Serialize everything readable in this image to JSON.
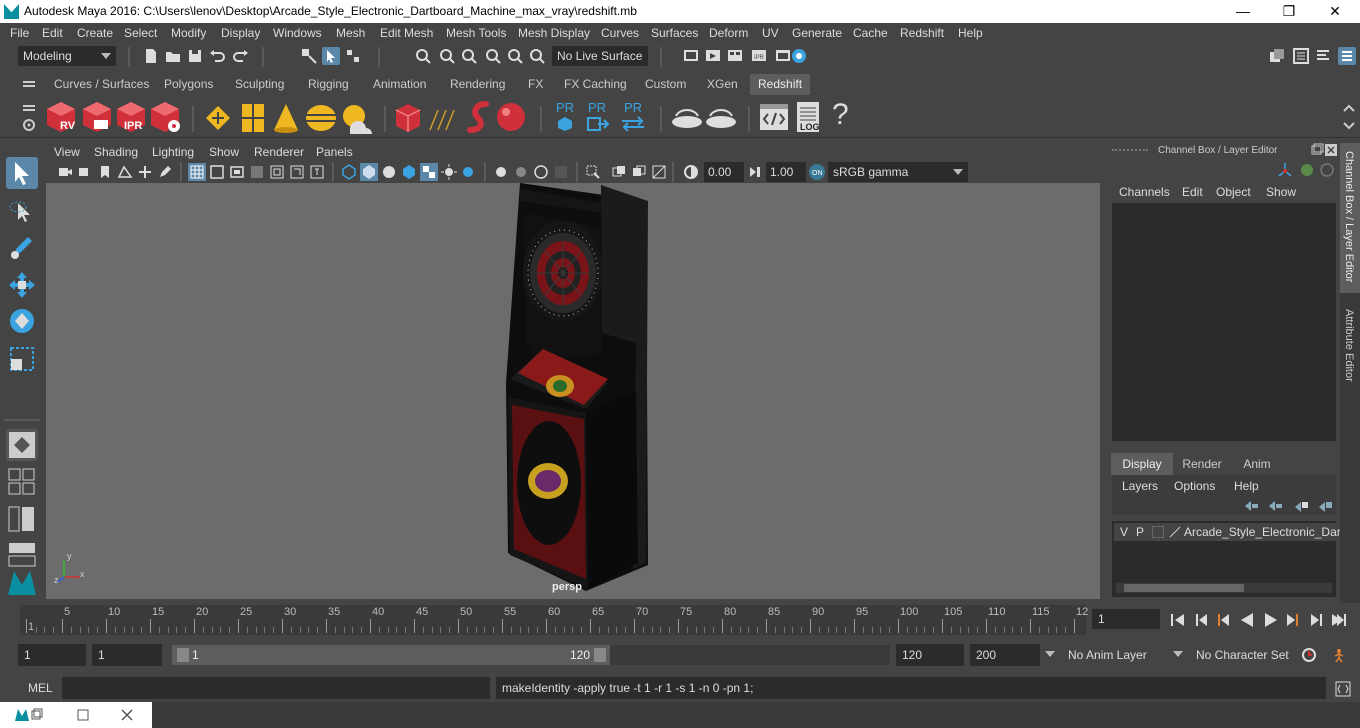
{
  "window": {
    "title": "Autodesk Maya 2016: C:\\Users\\lenov\\Desktop\\Arcade_Style_Electronic_Dartboard_Machine_max_vray\\redshift.mb",
    "minimize": "—",
    "maximize": "❐",
    "close": "✕"
  },
  "menubar": [
    "File",
    "Edit",
    "Create",
    "Select",
    "Modify",
    "Display",
    "Windows",
    "Mesh",
    "Edit Mesh",
    "Mesh Tools",
    "Mesh Display",
    "Curves",
    "Surfaces",
    "Deform",
    "UV",
    "Generate",
    "Cache",
    "Redshift",
    "Help"
  ],
  "statusline": {
    "mode": "Modeling",
    "live_surface": "No Live Surface"
  },
  "shelf_tabs": [
    "Curves / Surfaces",
    "Polygons",
    "Sculpting",
    "Rigging",
    "Animation",
    "Rendering",
    "FX",
    "FX Caching",
    "Custom",
    "XGen",
    "Redshift"
  ],
  "shelf_active_tab": "Redshift",
  "shelf_icons": {
    "rv": "RV",
    "ipr": "IPR",
    "pr": "PR",
    "log": "LOG",
    "help": "?"
  },
  "viewport": {
    "menu": [
      "View",
      "Shading",
      "Lighting",
      "Show",
      "Renderer",
      "Panels"
    ],
    "gamma_min": "0.00",
    "gamma_max": "1.00",
    "color_space": "sRGB gamma",
    "camera": "persp",
    "axis": {
      "x": "x",
      "y": "y",
      "z": "z"
    }
  },
  "channel_box": {
    "title": "Channel Box / Layer Editor",
    "menu": [
      "Channels",
      "Edit",
      "Object",
      "Show"
    ],
    "layer_tabs": [
      "Display",
      "Render",
      "Anim"
    ],
    "layer_menu": [
      "Layers",
      "Options",
      "Help"
    ],
    "layer": {
      "v": "V",
      "p": "P",
      "name": "Arcade_Style_Electronic_Dart"
    }
  },
  "side_tabs": {
    "channel": "Channel Box / Layer Editor",
    "attribute": "Attribute Editor"
  },
  "timeline": {
    "ticks": [
      "1",
      "5",
      "10",
      "15",
      "20",
      "25",
      "30",
      "35",
      "40",
      "45",
      "50",
      "55",
      "60",
      "65",
      "70",
      "75",
      "80",
      "85",
      "90",
      "95",
      "100",
      "105",
      "110",
      "115",
      "12"
    ],
    "current_frame": "1"
  },
  "range": {
    "start": "1",
    "playback_start": "1",
    "slider_start": "1",
    "slider_end": "120",
    "playback_end": "120",
    "end": "200",
    "anim_layer": "No Anim Layer",
    "character_set": "No Character Set"
  },
  "command_line": {
    "label": "MEL",
    "input": "",
    "output": "makeIdentity -apply true -t 1 -r 1 -s 1 -n 0 -pn 1;"
  },
  "colors": {
    "accent": "#5d5d5d",
    "redshift_red": "#d0303a",
    "pr_blue": "#3aa3e0",
    "viewport_bg": "#6c6c6c"
  }
}
